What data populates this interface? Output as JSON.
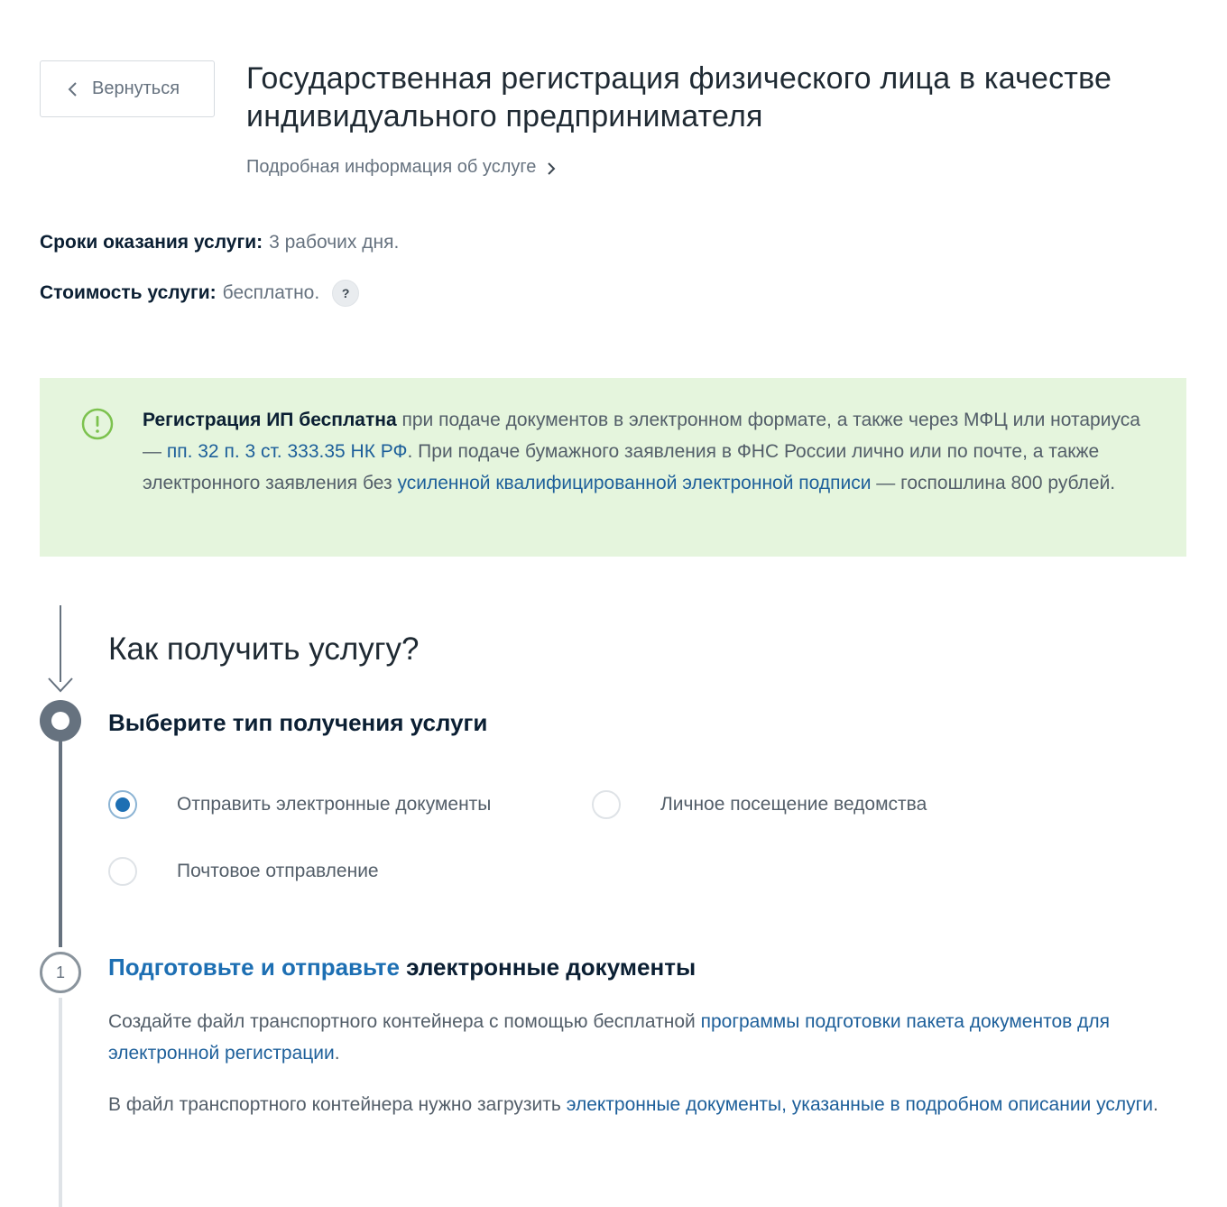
{
  "header": {
    "back_label": "Вернуться",
    "title": "Государственная регистрация физического лица в качестве индивидуального предпринимателя",
    "details_link": "Подробная информация об услуге"
  },
  "meta": {
    "time_label": "Сроки оказания услуги:",
    "time_value": "3 рабочих дня.",
    "cost_label": "Стоимость услуги:",
    "cost_value": "бесплатно.",
    "help_label": "?"
  },
  "info": {
    "icon": "exclamation-circle-icon",
    "accent_color": "#7cc24e",
    "background": "#e5f5dd",
    "bold": "Регистрация ИП бесплатна",
    "text_1": " при подаче документов в электронном формате, а также через МФЦ или нотариуса — ",
    "link_1": "пп. 32 п. 3 ст. 333.35 НК РФ",
    "text_2": ". При подаче бумажного заявления в ФНС России лично или по почте, а также электронного заявления без ",
    "link_2": "усиленной квалифицированной электронной подписи",
    "text_3": " — госпошлина 800 рублей."
  },
  "how": {
    "title": "Как получить услугу?",
    "step0_title": "Выберите тип получения услуги",
    "options": [
      {
        "label": "Отправить электронные документы",
        "checked": true
      },
      {
        "label": "Личное посещение ведомства",
        "checked": false
      },
      {
        "label": "Почтовое отправление",
        "checked": false
      }
    ],
    "step1": {
      "number": "1",
      "title_link": "Подготовьте и отправьте",
      "title_rest": " электронные документы",
      "p1_text": "Создайте файл транспортного контейнера с помощью бесплатной ",
      "p1_link": "программы подготовки пакета документов для электронной регистрации",
      "p1_end": ".",
      "p2_text": "В файл транспортного контейнера нужно загрузить ",
      "p2_link": "электронные документы, указанные в подробном описании услуги",
      "p2_end": "."
    }
  },
  "colors": {
    "link": "#1d5f9a",
    "radio_checked": "#1d6fb3",
    "timeline": "#66727f"
  }
}
